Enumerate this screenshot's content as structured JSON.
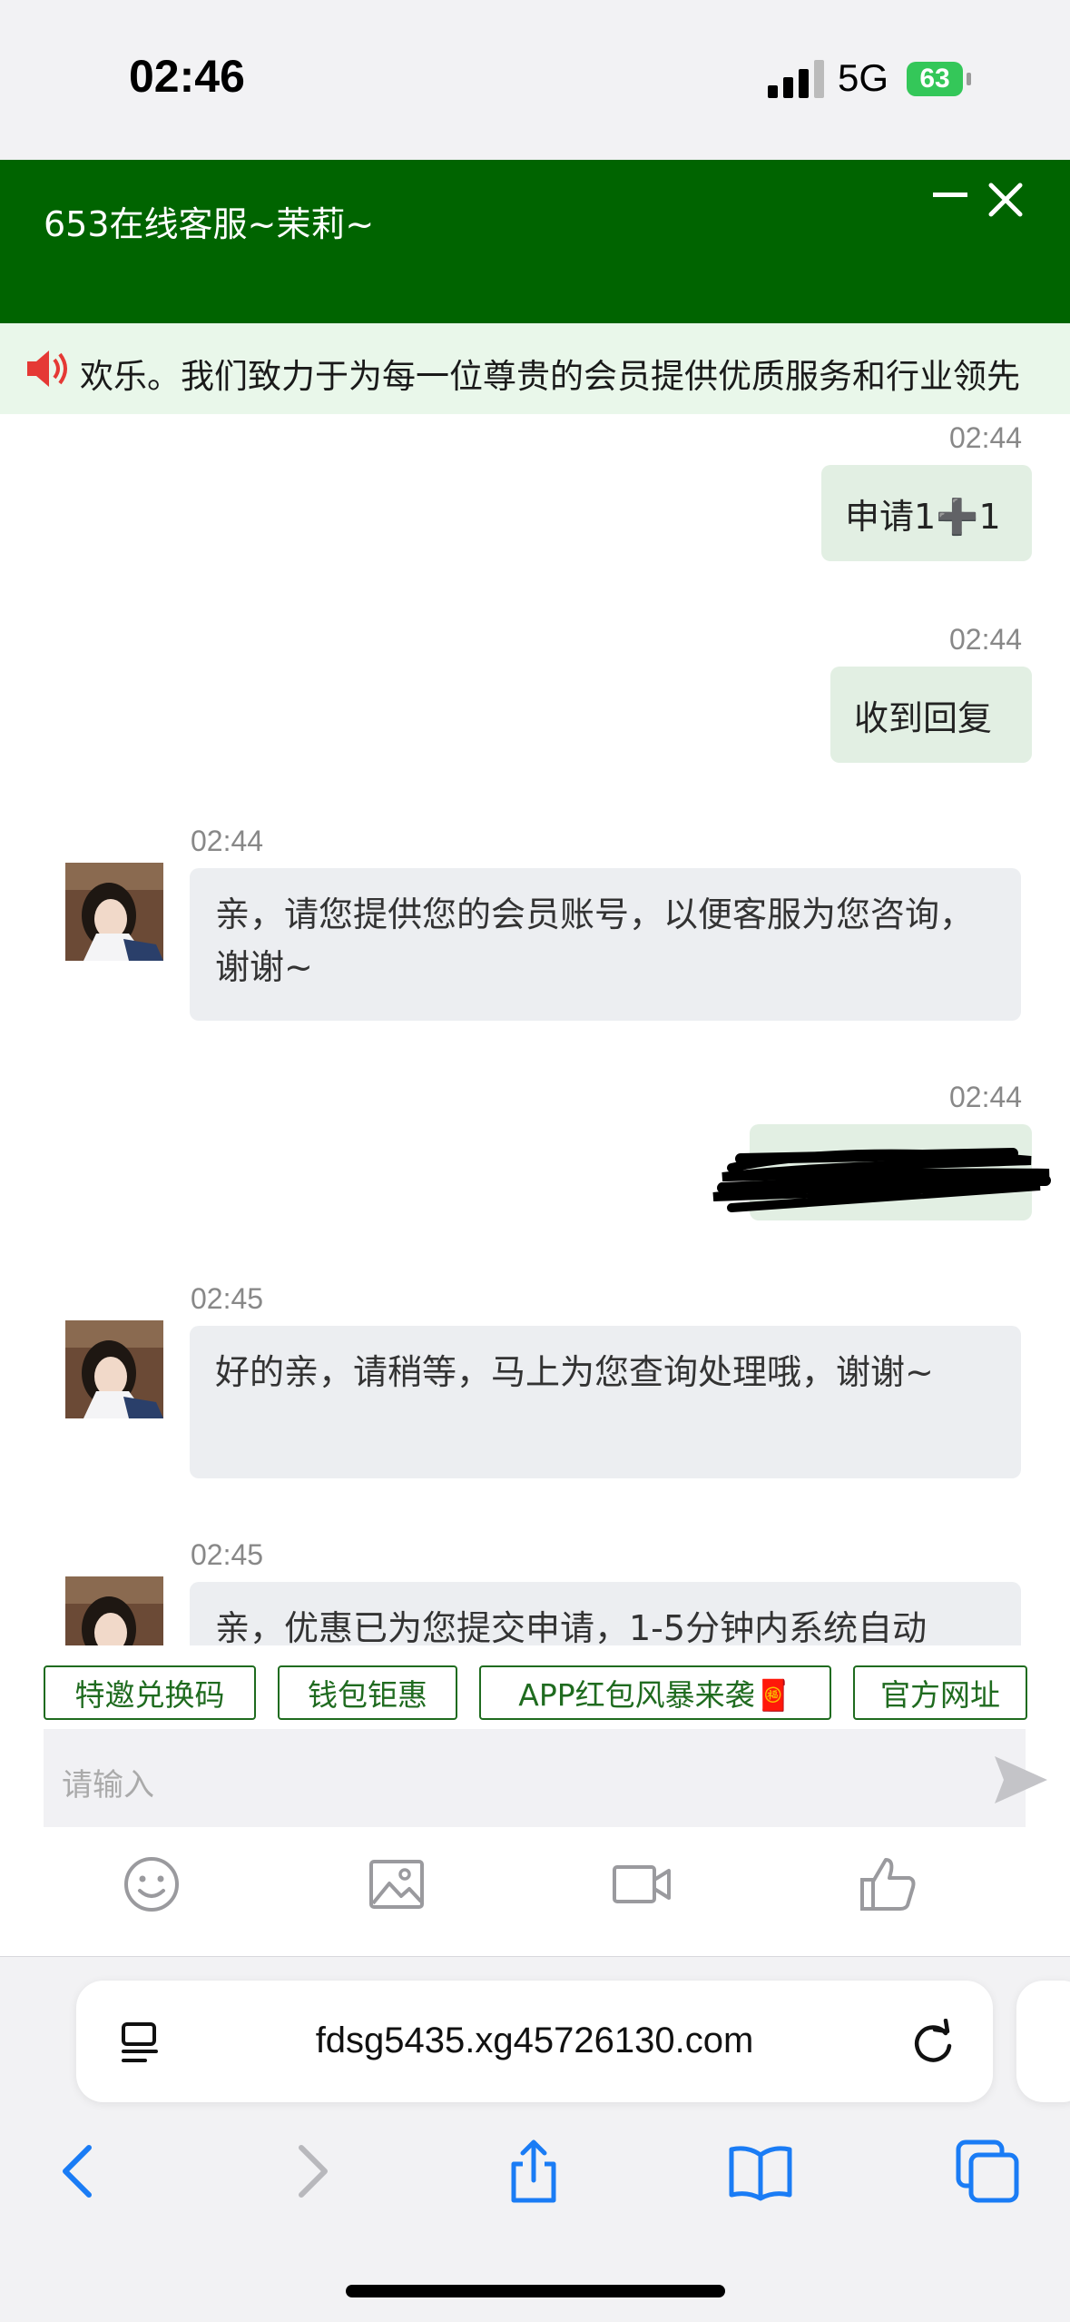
{
  "status_bar": {
    "time": "02:46",
    "network": "5G",
    "battery": "63"
  },
  "header": {
    "title": "653在线客服~茉莉~"
  },
  "notice": {
    "text": "欢乐。我们致力于为每一位尊贵的会员提供优质服务和行业领先"
  },
  "messages": [
    {
      "from": "me",
      "time": "02:44",
      "text": "申请1➕1"
    },
    {
      "from": "me",
      "time": "02:44",
      "text": "收到回复"
    },
    {
      "from": "agent",
      "time": "02:44",
      "text": "亲，请您提供您的会员账号，以便客服为您咨询，谢谢~"
    },
    {
      "from": "me",
      "time": "02:44",
      "text": ""
    },
    {
      "from": "agent",
      "time": "02:45",
      "text": "好的亲，请稍等，马上为您查询处理哦，谢谢~"
    },
    {
      "from": "agent",
      "time": "02:45",
      "text": "亲，优惠已为您提交申请，1-5分钟内系统自动"
    }
  ],
  "quick_replies": [
    "特邀兑换码",
    "钱包钜惠",
    "APP红包风暴来袭🧧",
    "官方网址"
  ],
  "input": {
    "placeholder": "请输入"
  },
  "toolbar_icons": [
    "emoji-icon",
    "image-icon",
    "video-icon",
    "thumbs-up-icon"
  ],
  "browser": {
    "url": "fdsg5435.xg45726130.com"
  },
  "colors": {
    "header": "#006400",
    "accent": "#1f6b1f",
    "my_bubble": "#e2efe3",
    "agent_bubble": "#eceef1",
    "safari_blue": "#1a7cf5"
  }
}
